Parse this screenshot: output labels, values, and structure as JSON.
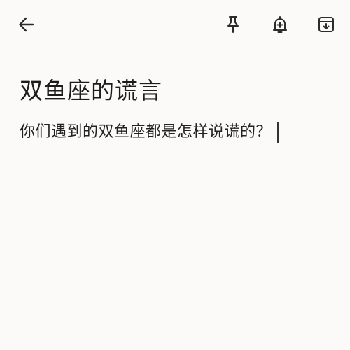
{
  "toolbar": {
    "back_icon": "arrow-left-icon",
    "pin_icon": "pin-icon",
    "reminder_icon": "bell-plus-icon",
    "archive_icon": "archive-icon",
    "icon_color": "#2b2b2b"
  },
  "note": {
    "title": "双鱼座的谎言",
    "body": "你们遇到的双鱼座都是怎样说谎的？"
  },
  "colors": {
    "background": "#fbfaf9",
    "text": "#1f1f1f"
  }
}
